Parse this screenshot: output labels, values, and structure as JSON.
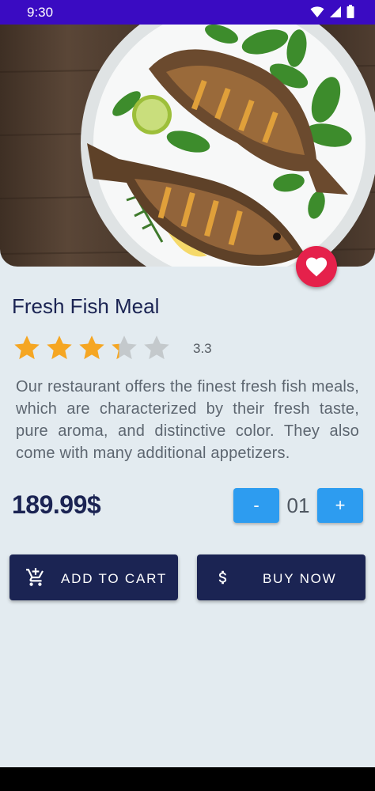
{
  "status_bar": {
    "time": "9:30"
  },
  "product": {
    "title": "Fresh Fish Meal",
    "rating": 3.3,
    "rating_text": "3.3",
    "rating_max": 5,
    "description": "Our restaurant offers the finest fresh fish meals, which are characterized by their fresh taste, pure aroma, and distinctive color. They also come with many additional appetizers.",
    "price": "189.99$"
  },
  "quantity": {
    "minus_label": "-",
    "value": "01",
    "plus_label": "+"
  },
  "actions": {
    "add_to_cart_label": "ADD TO CART",
    "buy_now_label": "BUY NOW"
  },
  "icons": {
    "status": [
      "wifi-icon",
      "signal-icon",
      "battery-icon"
    ],
    "favorite": "heart-icon",
    "cart": "add-shopping-cart-icon",
    "buy": "dollar-icon"
  },
  "colors": {
    "status_bar": "#3a0bc2",
    "background": "#e3ebf0",
    "primary_dark": "#1b2453",
    "accent_blue": "#2d9cf0",
    "favorite_red": "#e5214b",
    "star_filled": "#f5a623",
    "star_empty": "#c4c9cc"
  }
}
